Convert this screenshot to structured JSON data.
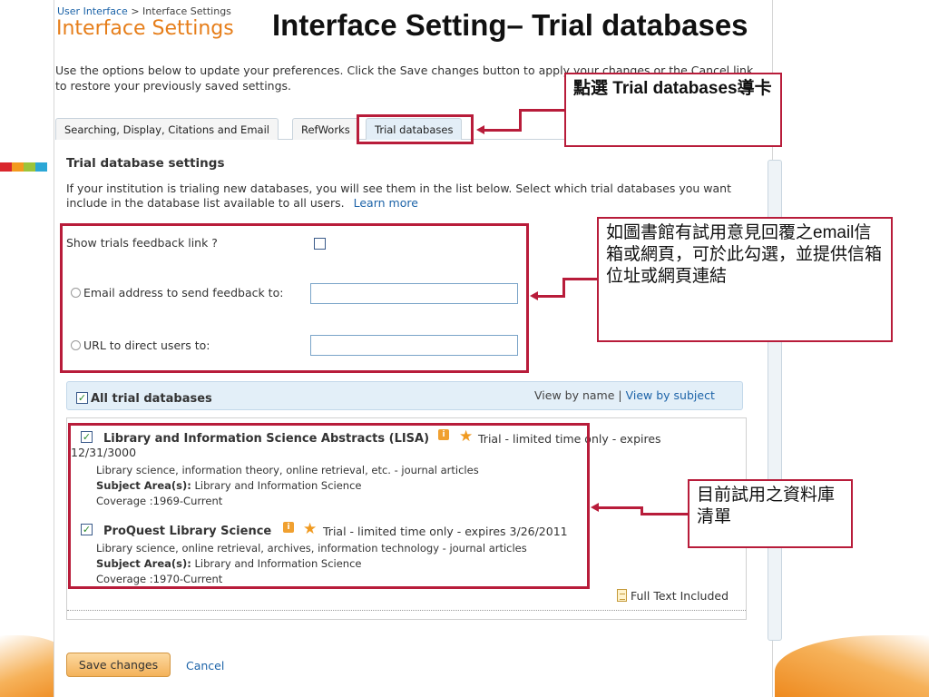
{
  "slide_title": "Interface Setting– Trial databases",
  "breadcrumb": {
    "parent": "User Interface",
    "separator": ">",
    "current": "Interface Settings"
  },
  "page_heading": "Interface Settings",
  "intro_text": "Use the options below to update your preferences. Click the Save changes button to apply your changes or the Cancel link to restore your previously saved settings.",
  "tabs": [
    {
      "label": "Searching, Display, Citations and Email"
    },
    {
      "label": "RefWorks"
    },
    {
      "label": "Trial databases"
    }
  ],
  "section": {
    "title": "Trial database settings",
    "description": "If your institution is trialing new databases, you will see them in the list below. Select which trial databases you want include in the database list available to all users.",
    "learn_more": "Learn more"
  },
  "feedback": {
    "show_link_label": "Show trials feedback link ?",
    "email_label": "Email address to send feedback to:",
    "email_value": "",
    "url_label": "URL to direct users to:",
    "url_value": ""
  },
  "all_trials_label": "All trial databases",
  "view_by": {
    "name": "View by name",
    "separator": "|",
    "subject": "View by subject"
  },
  "databases": [
    {
      "name": "Library and Information Science Abstracts (LISA)",
      "trial": "Trial - limited time only - expires",
      "expires": "12/31/3000",
      "description": "Library science, information theory, online retrieval, etc. - journal articles",
      "subject_label": "Subject Area(s):",
      "subject": "Library and Information Science",
      "coverage": "Coverage :1969-Current"
    },
    {
      "name": "ProQuest Library Science",
      "trial": "Trial - limited time only - expires 3/26/2011",
      "description": "Library science, online retrieval, archives, information technology - journal articles",
      "subject_label": "Subject Area(s):",
      "subject": "Library and Information Science",
      "coverage": "Coverage :1970-Current"
    }
  ],
  "full_text_label": "Full Text Included",
  "buttons": {
    "save": "Save changes",
    "cancel": "Cancel"
  },
  "callouts": {
    "tab": "點選 Trial databases導卡",
    "feedback": "如圖書館有試用意見回覆之email信箱或網頁，可於此勾選，並提供信箱位址或網頁連結",
    "list": "目前試用之資料庫清單"
  },
  "colors": {
    "accent_orange": "#e67e1a",
    "link_blue": "#1c63a8",
    "callout_red": "#b81c3a"
  }
}
